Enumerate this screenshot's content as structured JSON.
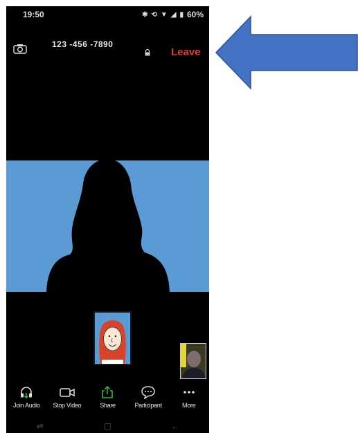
{
  "status_bar": {
    "time": "19:50",
    "battery": "60%",
    "indicators": [
      "bluetooth-icon",
      "sync-icon",
      "wifi-icon",
      "signal-icon",
      "battery-icon"
    ]
  },
  "top_bar": {
    "meeting_id": "123 -456 -7890",
    "leave_label": "Leave",
    "leave_color": "#e53a36",
    "icons": [
      "camera-flip-icon",
      "lock-icon"
    ]
  },
  "video": {
    "background_color": "#5b9bd5"
  },
  "toolbar": {
    "items": [
      {
        "label": "Join Audio",
        "icon": "headphones-icon"
      },
      {
        "label": "Stop Video",
        "icon": "video-camera-icon"
      },
      {
        "label": "Share",
        "icon": "share-icon"
      },
      {
        "label": "Participant",
        "icon": "chat-bubble-icon"
      },
      {
        "label": "More",
        "icon": "more-icon"
      }
    ]
  },
  "nav_bar": {
    "items": [
      "recent-apps-icon",
      "home-icon",
      "back-icon"
    ]
  },
  "annotation": {
    "arrow_color": "#4472c4",
    "arrow_target": "leave-button"
  }
}
